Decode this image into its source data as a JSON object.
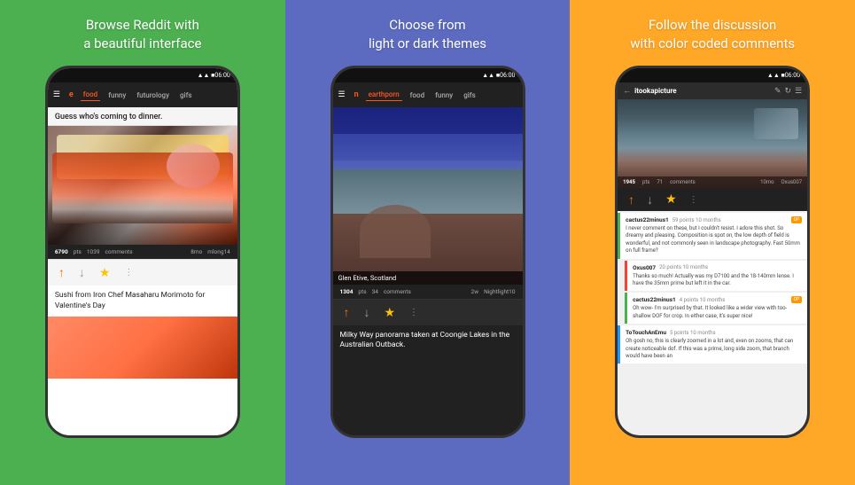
{
  "panels": [
    {
      "id": "panel-1",
      "title": "Browse Reddit with\na beautiful interface",
      "bg": "#4caf50",
      "phone_theme": "light",
      "status": "06:00",
      "nav_items": [
        "≡",
        "e",
        "food",
        "funny",
        "futurology",
        "gifs"
      ],
      "active_tab": "food",
      "post": {
        "title_top": "Guess who's coming to dinner.",
        "pts": "6790",
        "pts_label": "pts",
        "comments": "1039",
        "comments_label": "comments",
        "time": "8mo",
        "user": "mlong14",
        "title_bottom": "Sushi from Iron Chef Masaharu Morimoto for Valentine's Day"
      }
    },
    {
      "id": "panel-2",
      "title": "Choose from\nlight or dark themes",
      "bg": "#5c6bc0",
      "phone_theme": "dark",
      "status": "06:00",
      "nav_items": [
        "≡",
        "n",
        "earthporn",
        "food",
        "funny",
        "gifs"
      ],
      "active_tab": "earthporn",
      "post": {
        "location": "Glen Etive, Scotland",
        "pts": "1304",
        "pts_label": "pts",
        "comments": "34",
        "comments_label": "comments",
        "time": "2w",
        "user": "Nightlight10",
        "title_bottom": "Milky Way panorama taken at Coongie Lakes in the Australian Outback."
      }
    },
    {
      "id": "panel-3",
      "title": "Follow the discussion\nwith color coded comments",
      "bg": "#ffa726",
      "phone_theme": "dark",
      "status": "06:00",
      "subreddit": "itookapicture",
      "post_meta": {
        "pts": "1945",
        "pts_label": "pts",
        "comments": "71",
        "comments_label": "comments",
        "time": "10mo",
        "user": "Oxus007"
      },
      "comments": [
        {
          "user": "cactus22minus1",
          "pts": "59 points 10 months",
          "badge": "OP",
          "text": "I never comment on these, but I couldn't resist. I adore this shot. So dreamy and pleasing. Composition is spot on, the low depth of field is wonderful, and not commonly seen in landscape photography. Fast 50mm on full frame?"
        },
        {
          "user": "Oxus007",
          "pts": "20 points 10 months",
          "badge": "",
          "text": "Thanks so much! Actually was my D7100 and the 18-140mm lense. I have the 35mm prime but left it in the car.",
          "sub": true
        },
        {
          "user": "cactus22minus1",
          "pts": "4 points 10 months",
          "badge": "OP",
          "text": "Oh wow- I'm surprised by that. It looked like a wider view with too-shallow DOF for crop. In either case, it's super nice!",
          "sub": true
        },
        {
          "user": "ToTouchAnEmu",
          "pts": "5 points 10 months",
          "badge": "",
          "text": "Oh gosh no, this is clearly zoomed in a lot and, even on zooms, that can create noticeable dof. If this was a prime, long side zoom, that branch would have been an"
        }
      ]
    }
  ],
  "icons": {
    "hamburger": "☰",
    "back": "←",
    "edit": "✎",
    "refresh": "↻",
    "filter": "⚙",
    "up_arrow": "↑",
    "down_arrow": "↓",
    "star": "★",
    "more": "⋮",
    "clock": "🕐",
    "user": "👤"
  }
}
